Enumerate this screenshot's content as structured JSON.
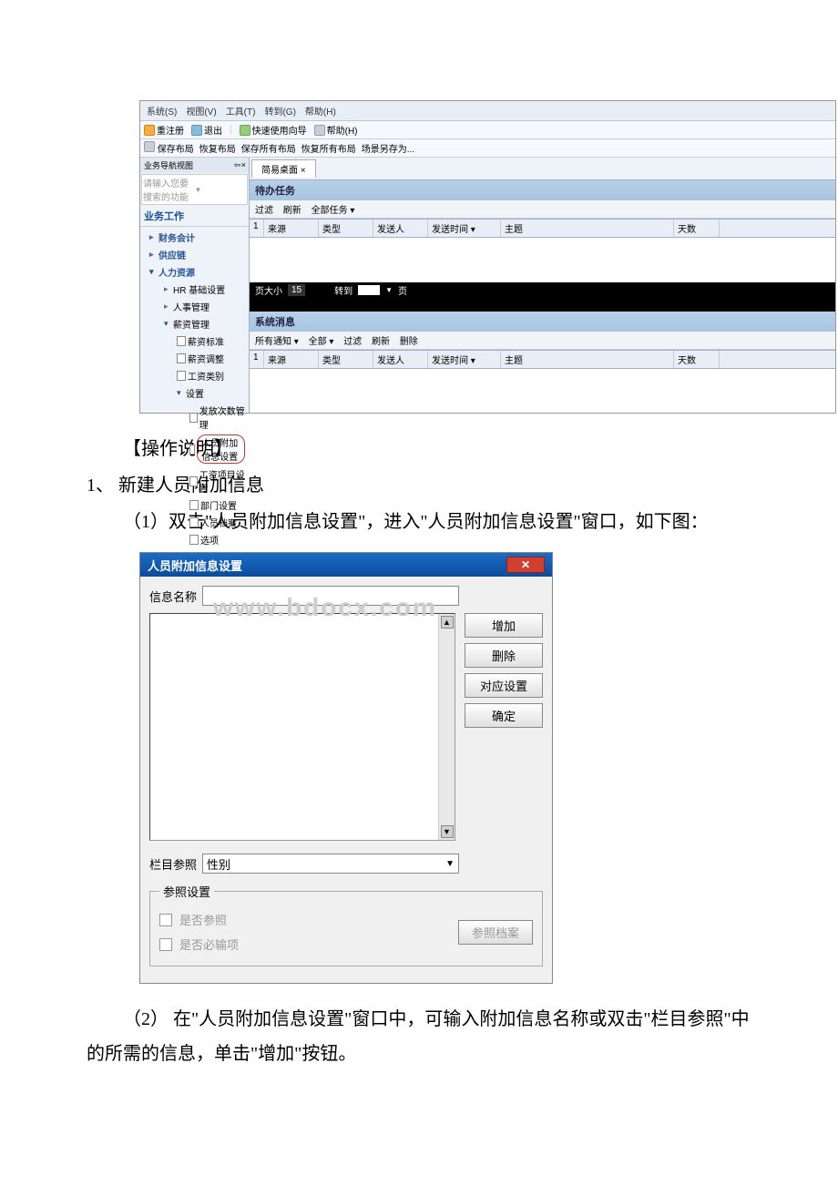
{
  "doc": {
    "operation_title": "【操作说明】",
    "step1_title": "1、 新建人员附加信息",
    "step1_1": "（1）双击\"人员附加信息设置\"，进入\"人员附加信息设置\"窗口，如下图：",
    "step1_2": "（2） 在\"人员附加信息设置\"窗口中，可输入附加信息名称或双击\"栏目参照\"中的所需的信息，单击\"增加\"按钮。"
  },
  "s1": {
    "menu": {
      "system": "系统(S)",
      "view": "视图(V)",
      "tool": "工具(T)",
      "goto": "转到(G)",
      "help": "帮助(H)"
    },
    "tb1": {
      "rereg": "重注册",
      "exit": "退出",
      "wizard": "快速使用向导",
      "help": "帮助(H)"
    },
    "tb2": {
      "save": "保存布局",
      "restore": "恢复布局",
      "saveAll": "保存所有布局",
      "restoreAll": "恢复所有布局",
      "saveAs": "场景另存为..."
    },
    "sidebar": {
      "title": "业务导航视图",
      "placeholder": "请输入您要搜索的功能",
      "bizTitle": "业务工作",
      "nav": {
        "finance": "财务会计",
        "supply": "供应链",
        "hr": "人力资源",
        "hrbase": "HR 基础设置",
        "hraffair": "人事管理",
        "payMgmt": "薪资管理",
        "payStd": "薪资标准",
        "payAdj": "薪资调整",
        "payClass": "工资类别",
        "settings": "设置",
        "issueMgmt": "发放次数管理",
        "personExtra": "人员附加信息设置",
        "payItem": "工资项目设置",
        "deptSet": "部门设置",
        "personFile": "人员档案",
        "option": "选项"
      }
    },
    "content": {
      "tab": "简易桌面",
      "panel1": "待办任务",
      "tools1": {
        "filter": "过滤",
        "refresh": "刷新",
        "all": "全部任务 ▾"
      },
      "cols": {
        "num": "1",
        "src": "来源",
        "type": "类型",
        "sender": "发送人",
        "sendtime": "发送时间",
        "subject": "主题",
        "days": "天数"
      },
      "pager": {
        "pageSizeLabel": "页大小",
        "pageSize": "15",
        "gotoLabel": "转到",
        "pageLabel": "页"
      },
      "panel2": "系统消息",
      "tools2": {
        "allnotice": "所有通知 ▾",
        "all": "全部 ▾",
        "filter": "过滤",
        "refresh": "刷新",
        "delete": "删除"
      }
    }
  },
  "s2": {
    "title": "人员附加信息设置",
    "label_name": "信息名称",
    "btn_add": "增加",
    "btn_del": "删除",
    "btn_map": "对应设置",
    "btn_ok": "确定",
    "label_ref": "栏目参照",
    "ref_value": "性别",
    "fieldset": "参照设置",
    "chk_isref": "是否参照",
    "chk_required": "是否必输项",
    "btn_reffile": "参照档案",
    "watermark": "www.bdocx.com"
  }
}
